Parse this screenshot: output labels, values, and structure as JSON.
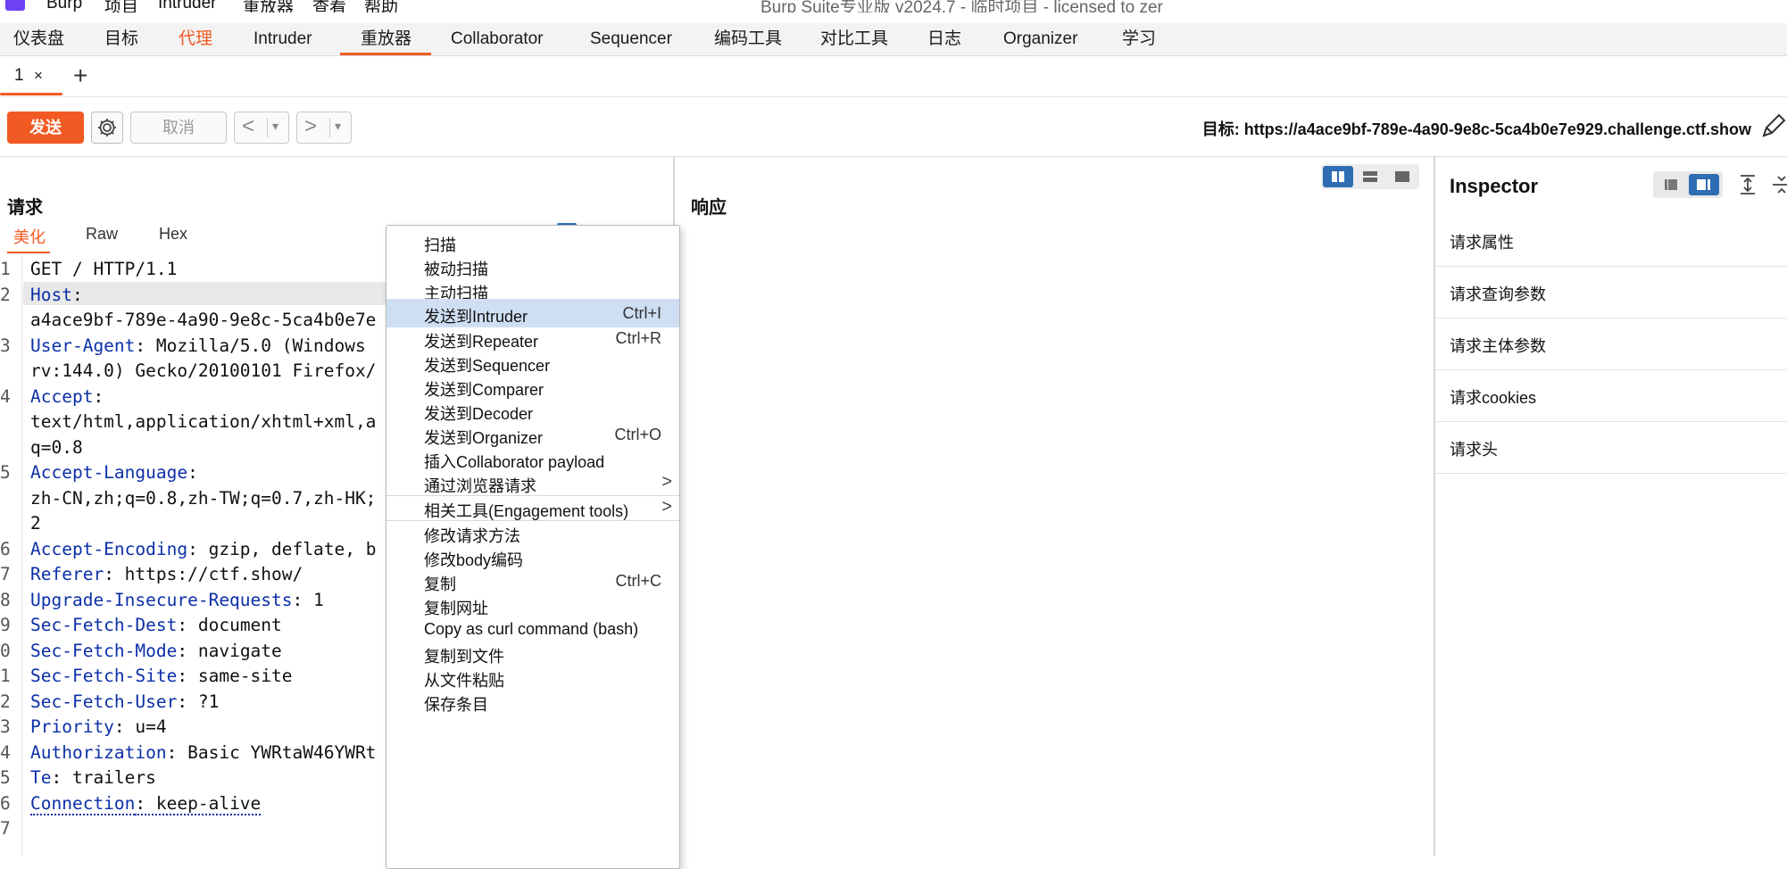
{
  "titlebar": {
    "menus": [
      "Burp",
      "项目",
      "Intruder",
      "重放器",
      "查看",
      "帮助"
    ],
    "app_title": "Burp Suite专业版  v2024.7 - 临时项目 - licensed to zer"
  },
  "main_tabs": [
    "仪表盘",
    "目标",
    "代理",
    "Intruder",
    "重放器",
    "Collaborator",
    "Sequencer",
    "编码工具",
    "对比工具",
    "日志",
    "Organizer",
    "学习"
  ],
  "sub_tabs": {
    "tab1_label": "1",
    "close": "×",
    "add": "+"
  },
  "toolbar": {
    "send_label": "发送",
    "cancel_label": "取消",
    "back_arrow": "<",
    "forward_arrow": ">",
    "dropdown": "▾",
    "target_prefix": "目标: ",
    "target_url": "https://a4ace9bf-789e-4a90-9e8c-5ca4b0e7e929.challenge.ctf.show"
  },
  "request": {
    "title": "请求",
    "tabs": [
      "美化",
      "Raw",
      "Hex"
    ],
    "active_tab": "美化",
    "line_numbers": [
      "1",
      "2",
      "",
      "3",
      "",
      "4",
      "",
      "",
      "5",
      "",
      "",
      "6",
      "7",
      "8",
      "9",
      "0",
      "1",
      "2",
      "3",
      "4",
      "5",
      "6",
      "7"
    ],
    "lines": [
      {
        "name": "",
        "value": "GET / HTTP/1.1"
      },
      {
        "name": "Host",
        "value": ":"
      },
      {
        "name": "",
        "value": "a4ace9bf-789e-4a90-9e8c-5ca4b0e7e"
      },
      {
        "name": "User-Agent",
        "value": ": Mozilla/5.0 (Windows"
      },
      {
        "name": "",
        "value": "rv:144.0) Gecko/20100101 Firefox/"
      },
      {
        "name": "Accept",
        "value": ":"
      },
      {
        "name": "",
        "value": "text/html,application/xhtml+xml,a"
      },
      {
        "name": "",
        "value": "q=0.8"
      },
      {
        "name": "Accept-Language",
        "value": ":"
      },
      {
        "name": "",
        "value": "zh-CN,zh;q=0.8,zh-TW;q=0.7,zh-HK;"
      },
      {
        "name": "",
        "value": "2"
      },
      {
        "name": "Accept-Encoding",
        "value": ": gzip, deflate, b"
      },
      {
        "name": "Referer",
        "value": ": https://ctf.show/"
      },
      {
        "name": "Upgrade-Insecure-Requests",
        "value": ": 1"
      },
      {
        "name": "Sec-Fetch-Dest",
        "value": ": document"
      },
      {
        "name": "Sec-Fetch-Mode",
        "value": ": navigate"
      },
      {
        "name": "Sec-Fetch-Site",
        "value": ": same-site"
      },
      {
        "name": "Sec-Fetch-User",
        "value": ": ?1"
      },
      {
        "name": "Priority",
        "value": ": u=4"
      },
      {
        "name": "Authorization",
        "value": ": Basic YWRtaW46YWRt"
      },
      {
        "name": "Te",
        "value": ": trailers"
      },
      {
        "name": "Connection",
        "value": ": keep-alive"
      },
      {
        "name": "",
        "value": ""
      }
    ]
  },
  "response": {
    "title": "响应"
  },
  "inspector": {
    "title": "Inspector",
    "sections": [
      "请求属性",
      "请求查询参数",
      "请求主体参数",
      "请求cookies",
      "请求头"
    ]
  },
  "context_menu": {
    "items": [
      {
        "label": "扫描",
        "shortcut": ""
      },
      {
        "label": "被动扫描",
        "shortcut": ""
      },
      {
        "label": "主动扫描",
        "shortcut": ""
      },
      {
        "label": "发送到Intruder",
        "shortcut": "Ctrl+I"
      },
      {
        "label": "发送到Repeater",
        "shortcut": "Ctrl+R"
      },
      {
        "label": "发送到Sequencer",
        "shortcut": ""
      },
      {
        "label": "发送到Comparer",
        "shortcut": ""
      },
      {
        "label": "发送到Decoder",
        "shortcut": ""
      },
      {
        "label": "发送到Organizer",
        "shortcut": "Ctrl+O"
      },
      {
        "label": "插入Collaborator payload",
        "shortcut": ""
      },
      {
        "label": "通过浏览器请求",
        "shortcut": ""
      },
      {
        "label": "相关工具(Engagement tools)",
        "shortcut": ""
      },
      {
        "label": "修改请求方法",
        "shortcut": ""
      },
      {
        "label": "修改body编码",
        "shortcut": ""
      },
      {
        "label": "复制",
        "shortcut": "Ctrl+C"
      },
      {
        "label": "复制网址",
        "shortcut": ""
      },
      {
        "label": "Copy as curl command (bash)",
        "shortcut": ""
      },
      {
        "label": "复制到文件",
        "shortcut": ""
      },
      {
        "label": "从文件粘贴",
        "shortcut": ""
      },
      {
        "label": "保存条目",
        "shortcut": ""
      }
    ],
    "submenu_arrow": ">",
    "highlighted": "发送到Intruder"
  },
  "colors": {
    "accent": "#f25a24",
    "highlight": "#cfdff3",
    "header_name": "#0b2fa8",
    "toggle_active": "#2e6db4"
  }
}
